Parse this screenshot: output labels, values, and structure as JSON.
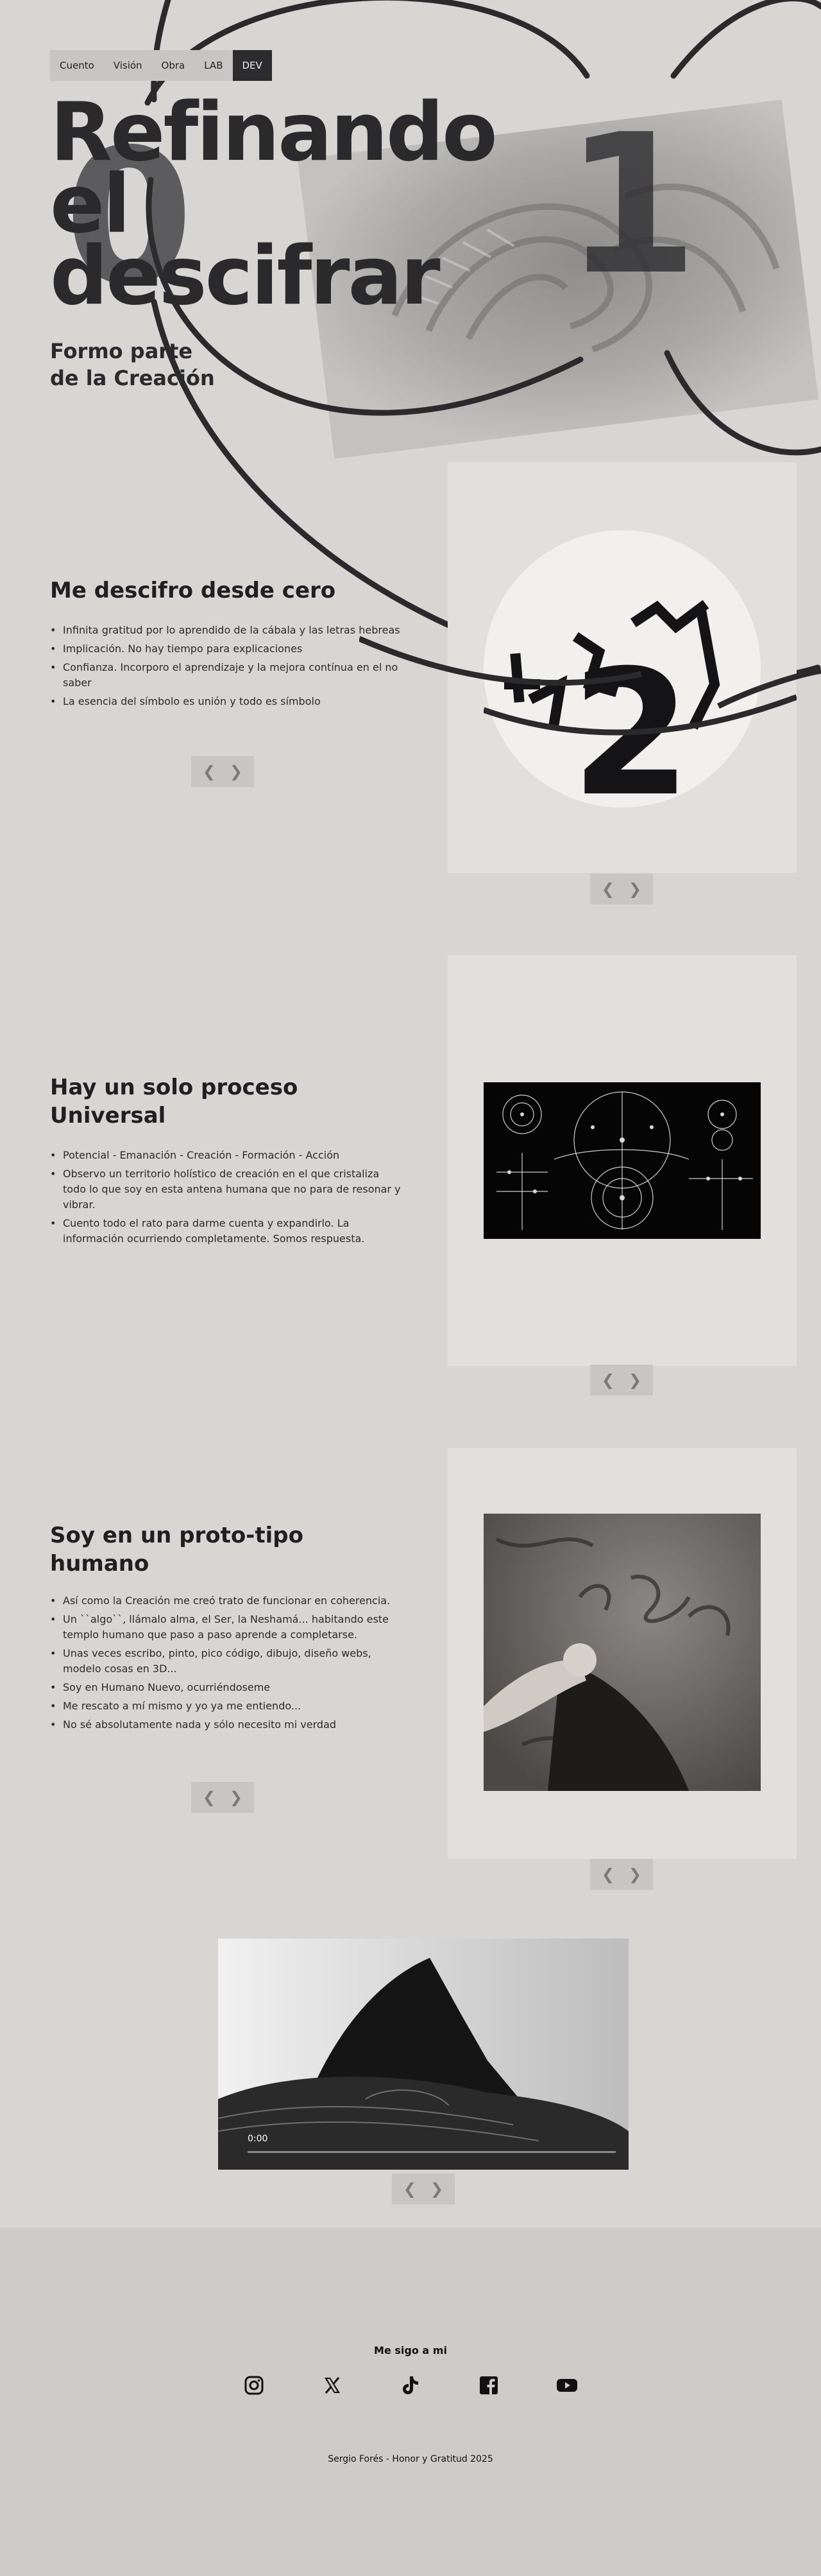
{
  "nav": {
    "items": [
      "Cuento",
      "Visión",
      "Obra",
      "LAB",
      "DEV"
    ],
    "active": "DEV"
  },
  "hero": {
    "title_lines": [
      "Refinando",
      "el",
      "descifrar"
    ],
    "digit_left": "0",
    "digit_right": "1",
    "subtitle_lines": [
      "Formo parte",
      "de la Creación"
    ]
  },
  "sections": [
    {
      "title": "Me descifro desde cero",
      "bullets": [
        "Infinita gratitud por lo aprendido de la cábala y las letras hebreas",
        "Implicación. No hay tiempo para explicaciones",
        "Confianza. Incorporo el aprendizaje y la mejora contínua en el no saber",
        "La esencia del símbolo es unión y todo es símbolo"
      ],
      "image_glyph": "2"
    },
    {
      "title_lines": [
        "Hay un solo proceso",
        "Universal"
      ],
      "bullets": [
        "Potencial - Emanación - Creación - Formación - Acción",
        "Observo un territorio holístico de creación en el que cristaliza todo lo que soy en esta antena humana que no para de resonar y vibrar.",
        "Cuento todo el rato para darme cuenta y expandirlo. La información ocurriendo completamente. Somos respuesta."
      ]
    },
    {
      "title_lines": [
        "Soy en un proto-tipo",
        "humano"
      ],
      "bullets": [
        "Así como la Creación me creó trato de funcionar en coherencia.",
        "Un ``algo``, llámalo alma, el Ser, la Neshamá... habitando este templo humano que paso a paso aprende a completarse.",
        "Unas veces escribo, pinto, pico código, dibujo, diseño webs, modelo cosas en 3D...",
        "Soy en Humano Nuevo, ocurriéndoseme",
        "Me rescato a mí mismo y yo ya me entiendo...",
        "No sé absolutamente nada y sólo necesito mi verdad"
      ]
    }
  ],
  "video": {
    "time": "0:00"
  },
  "arrows": {
    "prev": "❮",
    "next": "❯"
  },
  "footer": {
    "title": "Me sigo a mi",
    "socials": [
      "instagram-icon",
      "x-icon",
      "tiktok-icon",
      "facebook-icon",
      "youtube-icon"
    ],
    "copyright": "Sergio Forés - Honor y Gratitud 2025"
  }
}
